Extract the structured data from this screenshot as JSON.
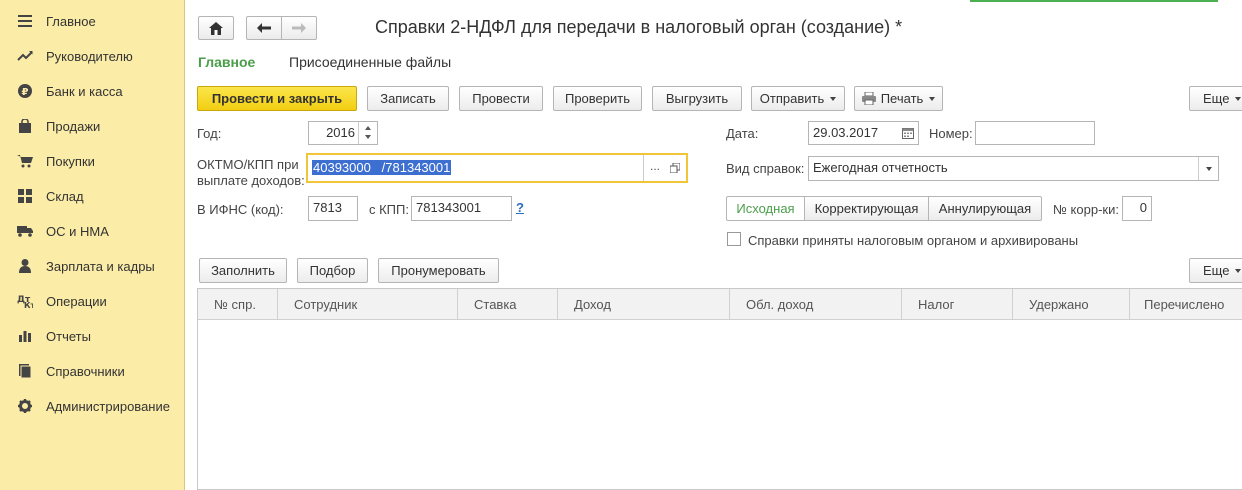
{
  "sidebar": {
    "items": [
      {
        "label": "Главное",
        "icon": "menu-icon"
      },
      {
        "label": "Руководителю",
        "icon": "chart-trend-icon"
      },
      {
        "label": "Банк и касса",
        "icon": "ruble-icon"
      },
      {
        "label": "Продажи",
        "icon": "bag-icon"
      },
      {
        "label": "Покупки",
        "icon": "cart-icon"
      },
      {
        "label": "Склад",
        "icon": "warehouse-icon"
      },
      {
        "label": "ОС и НМА",
        "icon": "truck-icon"
      },
      {
        "label": "Зарплата и кадры",
        "icon": "person-icon"
      },
      {
        "label": "Операции",
        "icon": "operations-icon"
      },
      {
        "label": "Отчеты",
        "icon": "bar-chart-icon"
      },
      {
        "label": "Справочники",
        "icon": "book-icon"
      },
      {
        "label": "Администрирование",
        "icon": "gear-icon"
      }
    ]
  },
  "header": {
    "title": "Справки 2-НДФЛ для передачи в налоговый орган (создание) *",
    "tabs": [
      {
        "label": "Главное",
        "active": true
      },
      {
        "label": "Присоединенные файлы",
        "active": false
      }
    ]
  },
  "toolbar": {
    "post_close": "Провести и закрыть",
    "save": "Записать",
    "post": "Провести",
    "check": "Проверить",
    "export": "Выгрузить",
    "send": "Отправить",
    "print": "Печать",
    "more": "Еще"
  },
  "form": {
    "year_label": "Год:",
    "year_value": "2016",
    "oktmo_label_1": "ОКТМО/КПП при",
    "oktmo_label_2": "выплате доходов:",
    "oktmo_value": "40393000   /781343001",
    "ifns_label": "В ИФНС (код):",
    "ifns_value": "7813",
    "kpp_label": "с КПП:",
    "kpp_value": "781343001",
    "help": "?",
    "date_label": "Дата:",
    "date_value": "29.03.2017",
    "number_label": "Номер:",
    "number_value": "",
    "type_label": "Вид справок:",
    "type_value": "Ежегодная отчетность",
    "kind_buttons": [
      {
        "label": "Исходная",
        "active": true
      },
      {
        "label": "Корректирующая",
        "active": false
      },
      {
        "label": "Аннулирующая",
        "active": false
      }
    ],
    "corr_label": "№ корр-ки:",
    "corr_value": "0",
    "archived_label": "Справки приняты налоговым органом и архивированы",
    "archived_checked": false
  },
  "table_toolbar": {
    "fill": "Заполнить",
    "select": "Подбор",
    "renumber": "Пронумеровать",
    "more": "Еще"
  },
  "table": {
    "columns": [
      "№ спр.",
      "Сотрудник",
      "Ставка",
      "Доход",
      "Обл. доход",
      "Налог",
      "Удержано",
      "Перечислено"
    ],
    "rows": []
  },
  "colors": {
    "sidebar_bg": "#fbeca8",
    "primary_button": "#f3cf13",
    "active_tab": "#4a9e4a",
    "selection": "#3d6fd0"
  }
}
